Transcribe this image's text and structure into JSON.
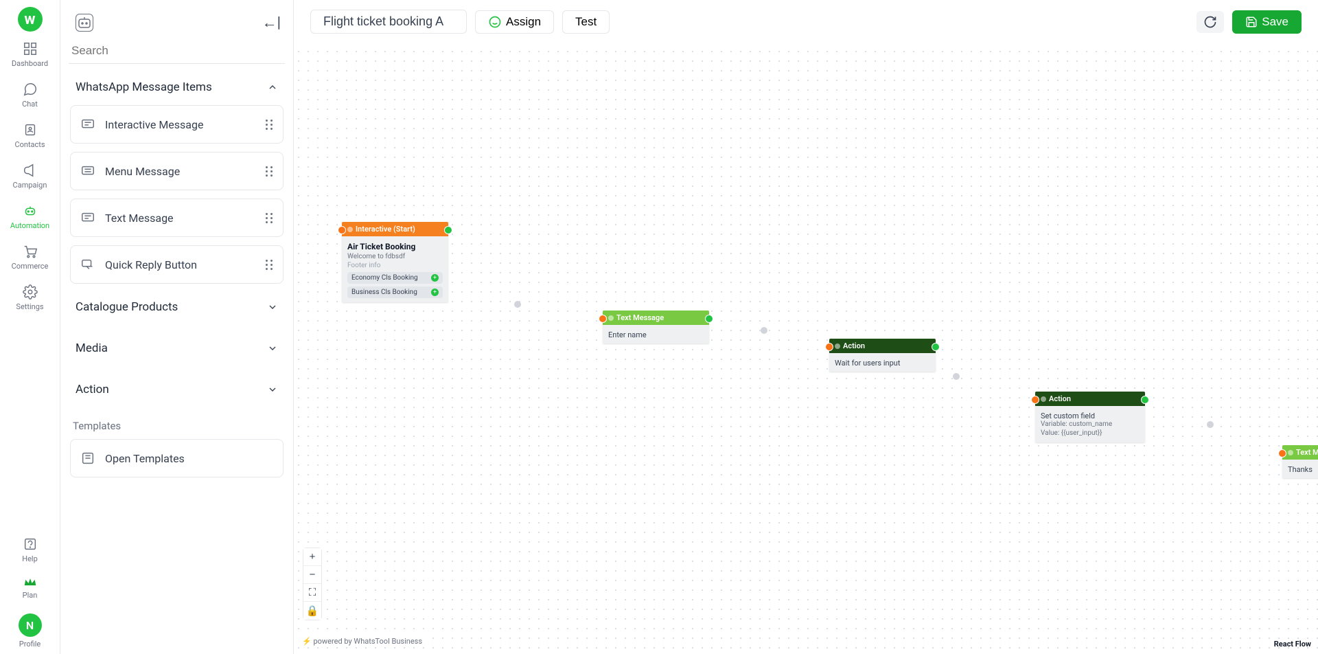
{
  "nav": {
    "logo_letter": "w",
    "items": [
      {
        "label": "Dashboard"
      },
      {
        "label": "Chat"
      },
      {
        "label": "Contacts"
      },
      {
        "label": "Campaign"
      },
      {
        "label": "Automation",
        "active": true
      },
      {
        "label": "Commerce"
      },
      {
        "label": "Settings"
      }
    ],
    "bottom": {
      "help": "Help",
      "plan": "Plan",
      "profile": "Profile",
      "avatar_initial": "N"
    }
  },
  "palette": {
    "search_placeholder": "Search",
    "sections": {
      "msg_items": "WhatsApp Message Items",
      "catalogue": "Catalogue Products",
      "media": "Media",
      "action": "Action"
    },
    "components": {
      "interactive": "Interactive Message",
      "menu": "Menu Message",
      "text": "Text Message",
      "quick_reply": "Quick Reply Button"
    },
    "templates_label": "Templates",
    "open_templates": "Open Templates"
  },
  "topbar": {
    "title": "Flight ticket booking A",
    "assign": "Assign",
    "test": "Test",
    "save": "Save"
  },
  "flow": {
    "start": {
      "header": "Interactive (Start)",
      "title": "Air Ticket Booking",
      "body": "Welcome to fdbsdf",
      "footer": "Footer info",
      "buttons": [
        "Economy Cls Booking",
        "Business Cls Booking"
      ]
    },
    "text1": {
      "header": "Text Message",
      "body": "Enter name"
    },
    "action1": {
      "header": "Action",
      "body": "Wait for users input"
    },
    "action2": {
      "header": "Action",
      "title": "Set custom field",
      "var_label": "Variable: custom_name",
      "val_label": "Value: {{user_input}}"
    },
    "text2": {
      "header": "Text Message",
      "body": "Thanks"
    }
  },
  "footer": {
    "powered": "powered by WhatsTool Business",
    "attribution": "React Flow"
  }
}
